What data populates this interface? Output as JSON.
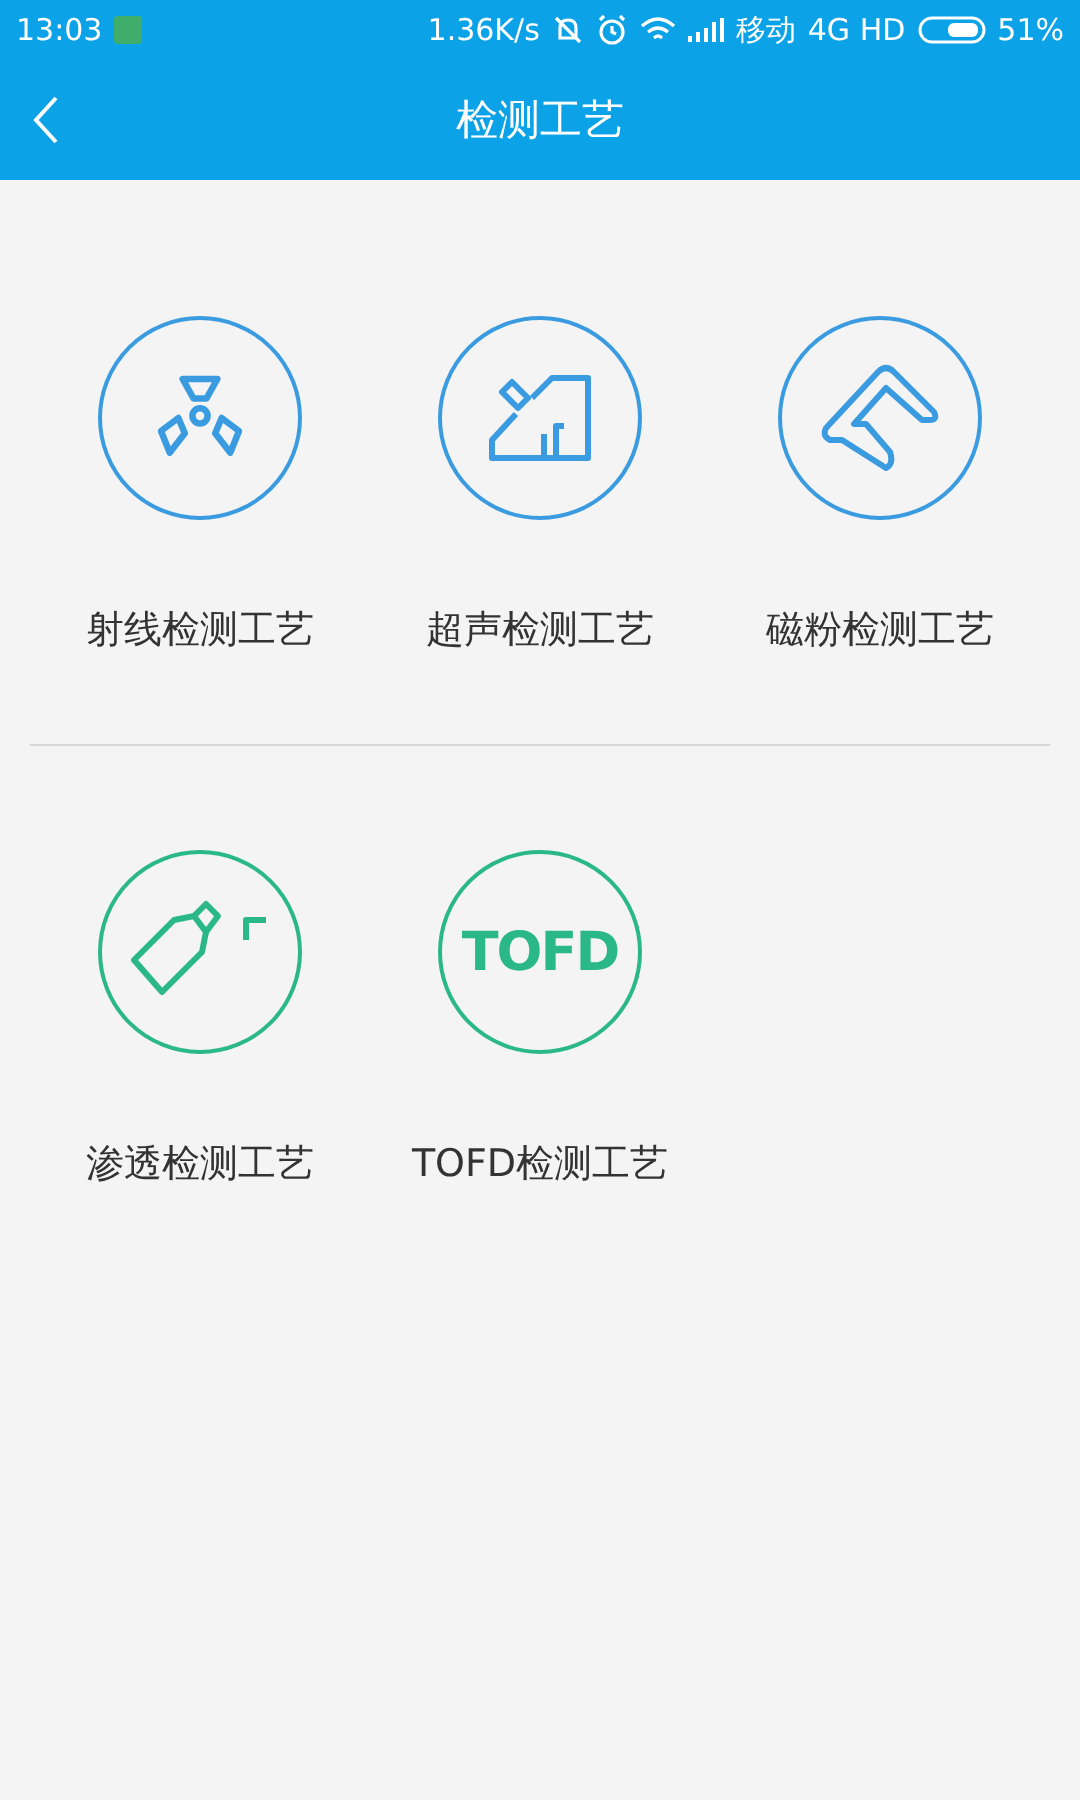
{
  "status_bar": {
    "time": "13:03",
    "speed": "1.36K/s",
    "carrier": "移动",
    "network": "4G HD",
    "battery": "51%"
  },
  "nav": {
    "title": "检测工艺"
  },
  "sections": [
    {
      "items": [
        {
          "label": "射线检测工艺",
          "kind": "radiation",
          "color": "#3a9be0"
        },
        {
          "label": "超声检测工艺",
          "kind": "ultrasound",
          "color": "#3a9be0"
        },
        {
          "label": "磁粉检测工艺",
          "kind": "magnet",
          "color": "#3a9be0"
        }
      ]
    },
    {
      "items": [
        {
          "label": "渗透检测工艺",
          "kind": "spray",
          "color": "#2bb889"
        },
        {
          "label": "TOFD检测工艺",
          "kind": "text",
          "icon_text": "TOFD",
          "color": "#2bb889"
        }
      ]
    }
  ]
}
